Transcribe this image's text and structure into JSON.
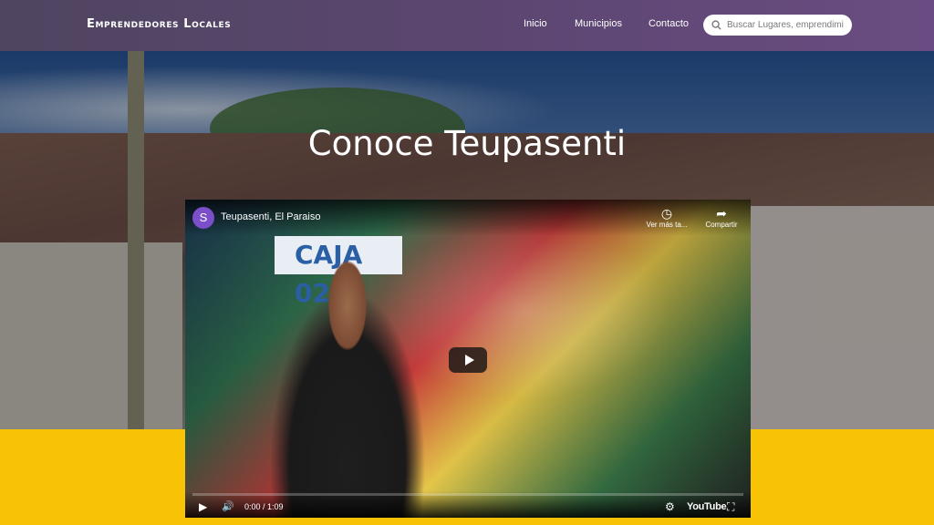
{
  "header": {
    "brand": "Emprendedores Locales",
    "nav": [
      "Inicio",
      "Municipios",
      "Contacto"
    ],
    "search_placeholder": "Buscar Lugares, emprendimientos"
  },
  "hero": {
    "title": "Conoce Teupasenti"
  },
  "video": {
    "channel_initial": "S",
    "title": "Teupasenti, El Paraiso",
    "watch_later_label": "Ver más ta...",
    "share_label": "Compartir",
    "time": "0:00 / 1:09",
    "progress_fraction": 0.0,
    "brand": "YouTube",
    "scene_sign": "CAJA 02"
  },
  "colors": {
    "header_bg": "#5b4670",
    "page_bg": "#f8c205",
    "avatar": "#7b4fc9"
  }
}
